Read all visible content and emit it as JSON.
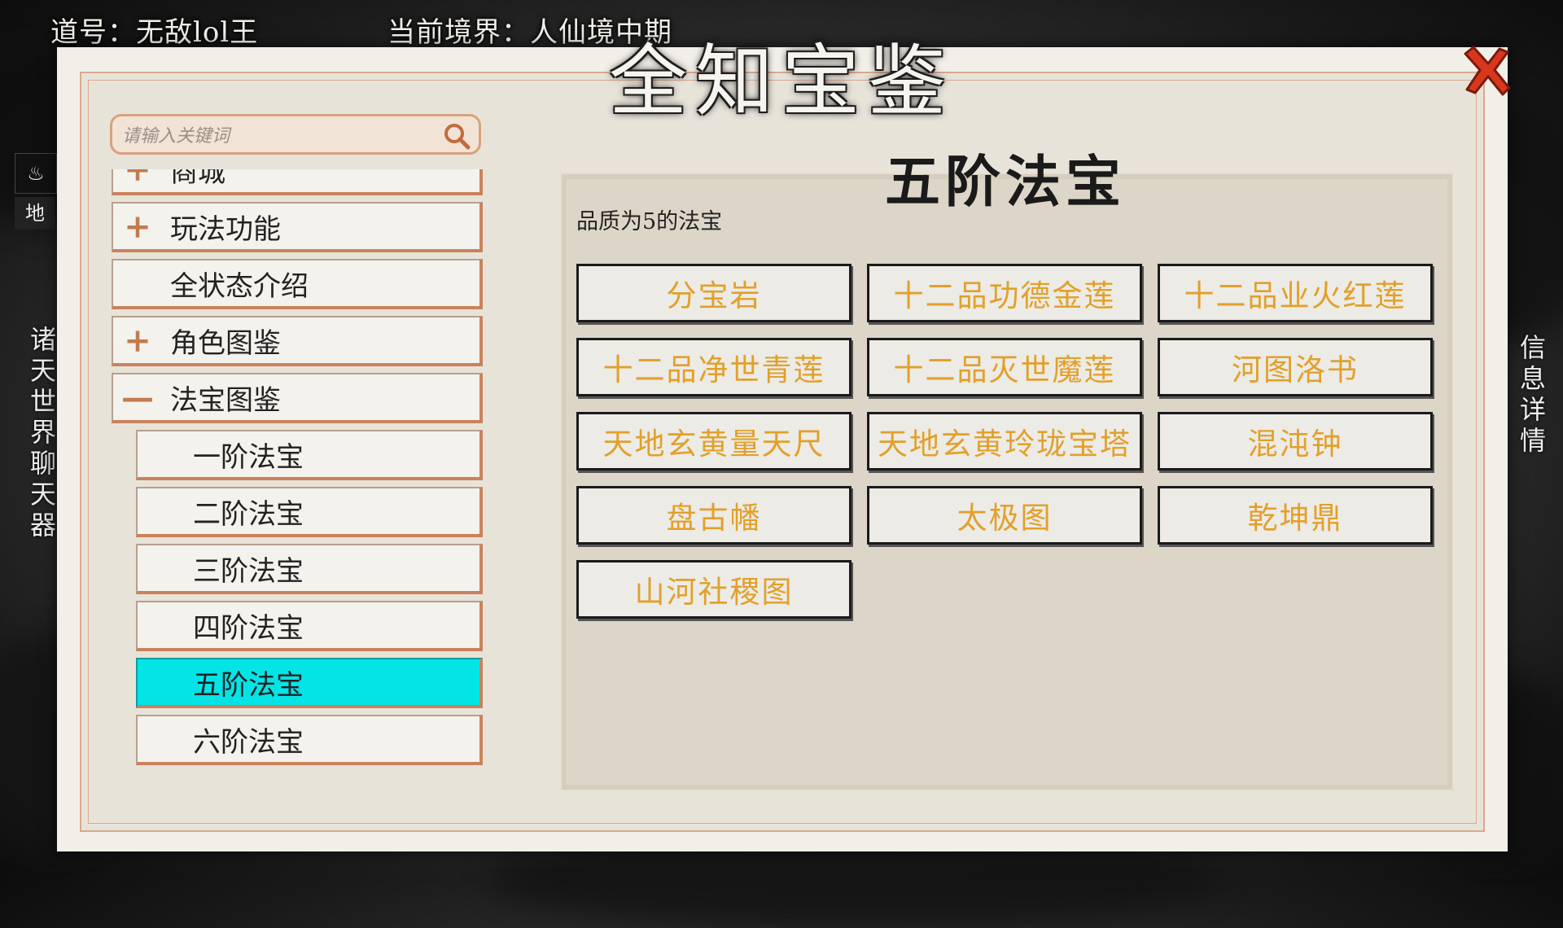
{
  "status": {
    "dao_name": "道号：无敌lol王",
    "realm": "当前境界：人仙境中期"
  },
  "side": {
    "chat_icon_label": "♨",
    "chat_sub": "地",
    "chat_vertical": "诸天世界聊天器",
    "info_vertical": "信息详情"
  },
  "dialog": {
    "title": "全知宝鉴",
    "close_icon": "close-x-icon"
  },
  "search": {
    "placeholder": "请输入关键词"
  },
  "tree": {
    "nodes": [
      {
        "label": "商城",
        "icon": "+"
      },
      {
        "label": "玩法功能",
        "icon": "+"
      },
      {
        "label": "全状态介绍",
        "icon": ""
      },
      {
        "label": "角色图鉴",
        "icon": "+"
      },
      {
        "label": "法宝图鉴",
        "icon": "—"
      }
    ],
    "children": [
      {
        "label": "一阶法宝"
      },
      {
        "label": "二阶法宝"
      },
      {
        "label": "三阶法宝"
      },
      {
        "label": "四阶法宝"
      },
      {
        "label": "五阶法宝",
        "active": true
      },
      {
        "label": "六阶法宝"
      }
    ]
  },
  "content": {
    "title": "五阶法宝",
    "description": "品质为5的法宝",
    "items": [
      "分宝岩",
      "十二品功德金莲",
      "十二品业火红莲",
      "十二品净世青莲",
      "十二品灭世魔莲",
      "河图洛书",
      "天地玄黄量天尺",
      "天地玄黄玲珑宝塔",
      "混沌钟",
      "盘古幡",
      "太极图",
      "乾坤鼎",
      "山河社稷图"
    ]
  },
  "colors": {
    "active_bg": "#03e4e6",
    "item_text": "#e2a02a",
    "close_red": "#d9361e"
  }
}
